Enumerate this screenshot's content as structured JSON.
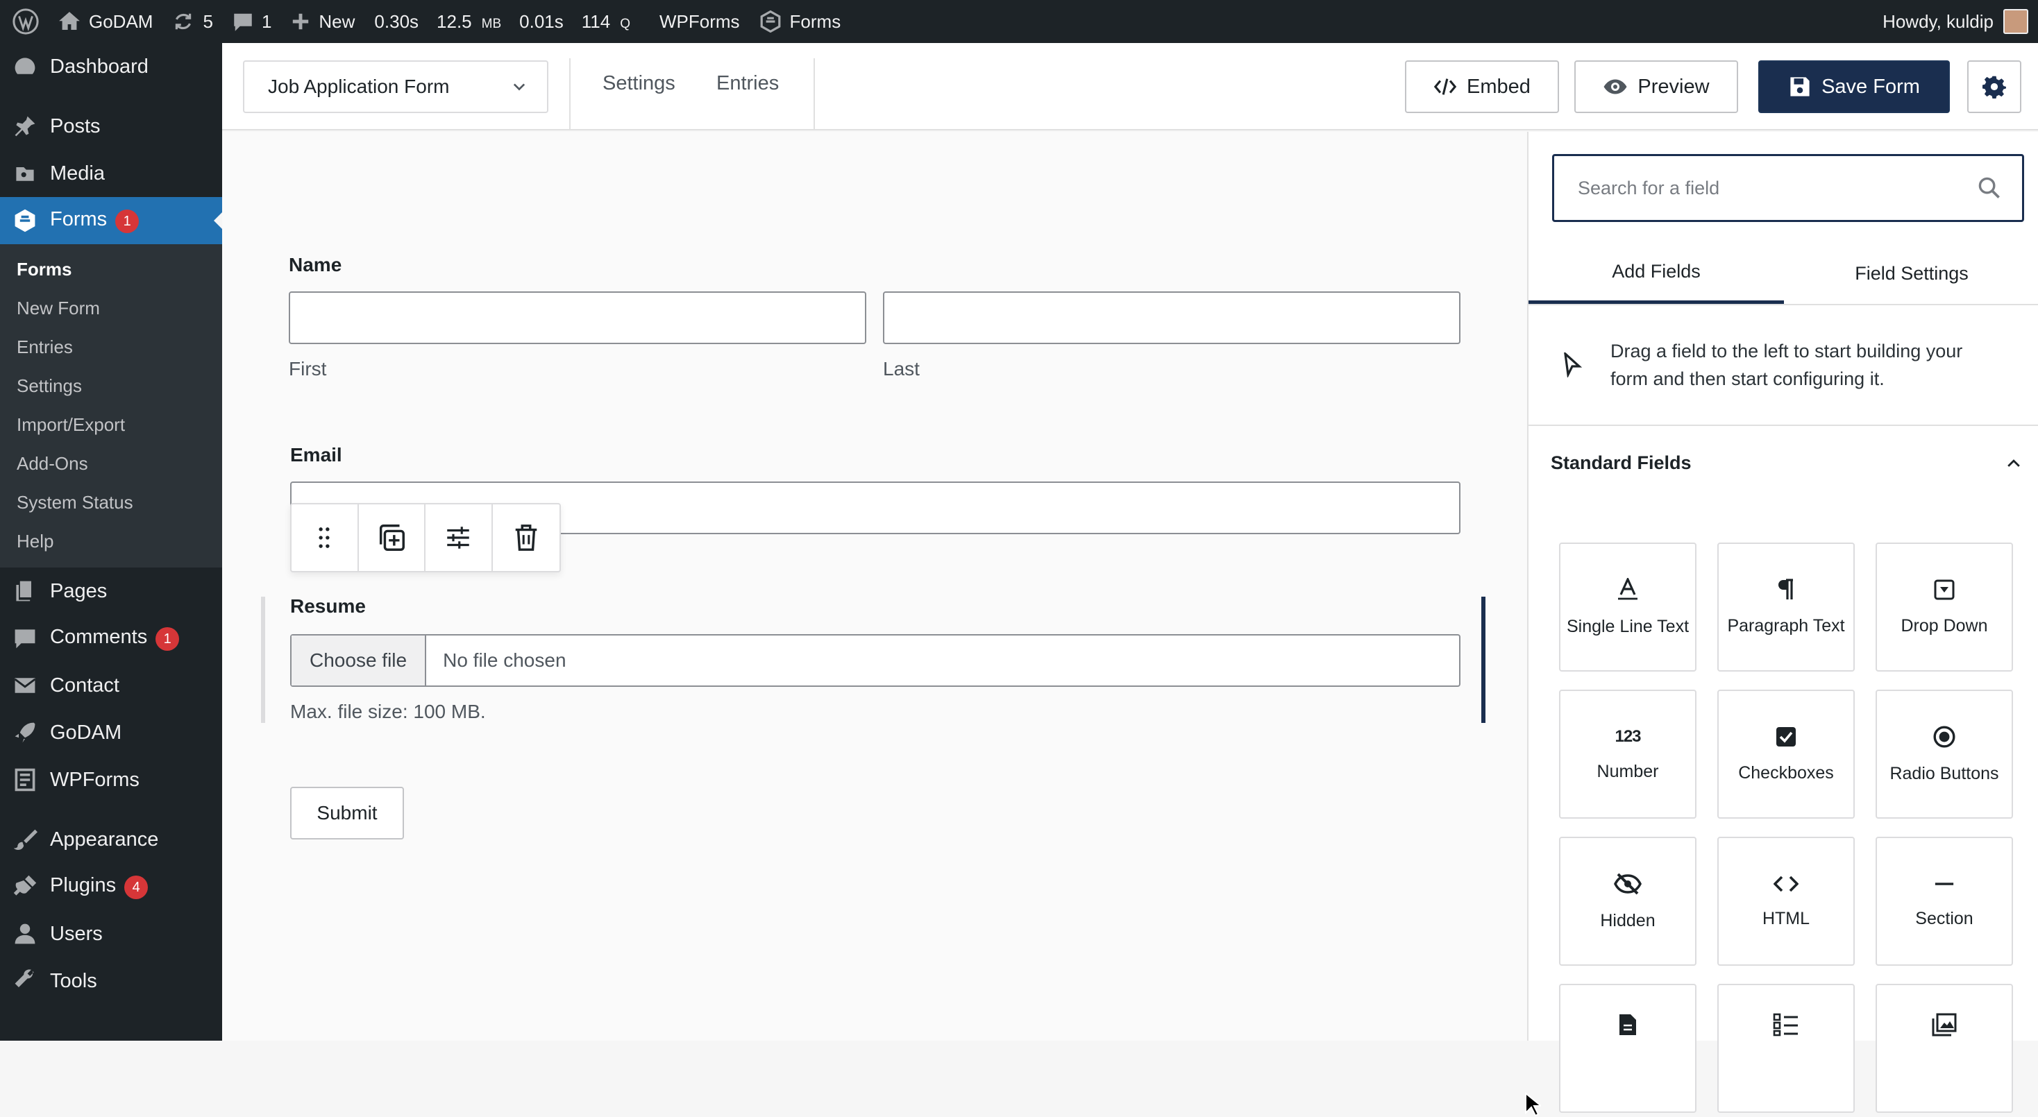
{
  "admin_bar": {
    "site_name": "GoDAM",
    "updates_count": "5",
    "comments_count": "1",
    "new_label": "New",
    "qm_time": "0.30s",
    "qm_memory": "12.5",
    "qm_memory_unit": "MB",
    "qm_db_time": "0.01s",
    "qm_queries": "114",
    "qm_queries_unit": "Q",
    "wpforms_label": "WPForms",
    "forms_label": "Forms",
    "howdy": "Howdy, kuldip"
  },
  "sidebar": {
    "dashboard": "Dashboard",
    "posts": "Posts",
    "media": "Media",
    "forms": "Forms",
    "forms_badge": "1",
    "forms_submenu": [
      "Forms",
      "New Form",
      "Entries",
      "Settings",
      "Import/Export",
      "Add-Ons",
      "System Status",
      "Help"
    ],
    "pages": "Pages",
    "comments": "Comments",
    "comments_badge": "1",
    "contact": "Contact",
    "godam": "GoDAM",
    "wpforms": "WPForms",
    "appearance": "Appearance",
    "plugins": "Plugins",
    "plugins_badge": "4",
    "users": "Users",
    "tools": "Tools"
  },
  "topbar": {
    "form_name": "Job Application Form",
    "settings_link": "Settings",
    "entries_link": "Entries",
    "embed_label": "Embed",
    "preview_label": "Preview",
    "save_label": "Save Form"
  },
  "form": {
    "name_label": "Name",
    "first_sublabel": "First",
    "last_sublabel": "Last",
    "email_label": "Email",
    "resume_label": "Resume",
    "choose_file": "Choose file",
    "no_file": "No file chosen",
    "max_size": "Max. file size: 100 MB.",
    "submit_label": "Submit"
  },
  "panel": {
    "search_placeholder": "Search for a field",
    "tab_add_fields": "Add Fields",
    "tab_field_settings": "Field Settings",
    "hint_line1": "Drag a field to the left to start building your",
    "hint_line2": "form and then start configuring it.",
    "standard_fields_title": "Standard Fields",
    "fields": [
      {
        "label": "Single Line Text",
        "icon": "single-line-text-icon"
      },
      {
        "label": "Paragraph Text",
        "icon": "paragraph-icon"
      },
      {
        "label": "Drop Down",
        "icon": "dropdown-icon"
      },
      {
        "label": "Number",
        "icon": "number-icon"
      },
      {
        "label": "Checkboxes",
        "icon": "checkbox-icon"
      },
      {
        "label": "Radio Buttons",
        "icon": "radio-icon"
      },
      {
        "label": "Hidden",
        "icon": "hidden-icon"
      },
      {
        "label": "HTML",
        "icon": "html-icon"
      },
      {
        "label": "Section",
        "icon": "section-icon"
      }
    ],
    "number_glyph": "123"
  }
}
